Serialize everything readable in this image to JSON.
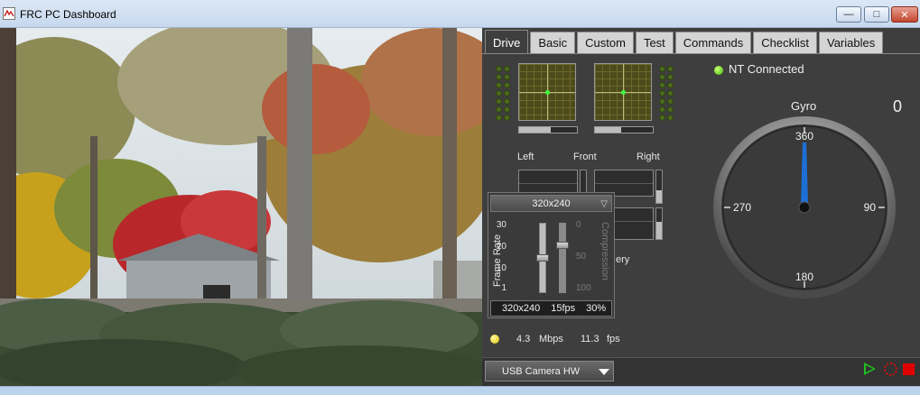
{
  "window": {
    "title": "FRC PC Dashboard"
  },
  "controls": {
    "minimize": "—",
    "maximize": "□",
    "close": "✕"
  },
  "tabs": [
    {
      "label": "Drive",
      "active": true
    },
    {
      "label": "Basic"
    },
    {
      "label": "Custom"
    },
    {
      "label": "Test"
    },
    {
      "label": "Commands"
    },
    {
      "label": "Checklist"
    },
    {
      "label": "Variables"
    }
  ],
  "drive": {
    "labels": {
      "left": "Left",
      "front": "Front",
      "right": "Right",
      "battery_partial": "ery"
    },
    "joystick_bars": [
      0.55,
      0.45
    ],
    "vertical_bars": [
      0.0,
      0.4,
      0.0,
      0.55
    ]
  },
  "network": {
    "status": "NT Connected",
    "status_color": "#3fb80c"
  },
  "gyro": {
    "title": "Gyro",
    "value": "0",
    "labels": {
      "top": "360",
      "right": "90",
      "bottom": "180",
      "left": "270"
    },
    "needle_color": "#1d6fd6"
  },
  "camera_settings": {
    "resolution_select": "320x240",
    "frame_rate_label": "Frame Rate",
    "compression_label": "Compression",
    "frame_rate_ticks": [
      "30",
      "20",
      "10",
      "1"
    ],
    "compression_ticks": [
      "0",
      "50",
      "100"
    ],
    "frame_rate_level": 0.5,
    "compression_level": 0.3,
    "status": {
      "resolution": "320x240",
      "fps": "15fps",
      "compression": "30%"
    }
  },
  "stats": {
    "bandwidth": "4.3",
    "bandwidth_unit": "Mbps",
    "framerate": "11.3",
    "framerate_unit": "fps"
  },
  "camera_source": {
    "selected": "USB Camera HW"
  }
}
